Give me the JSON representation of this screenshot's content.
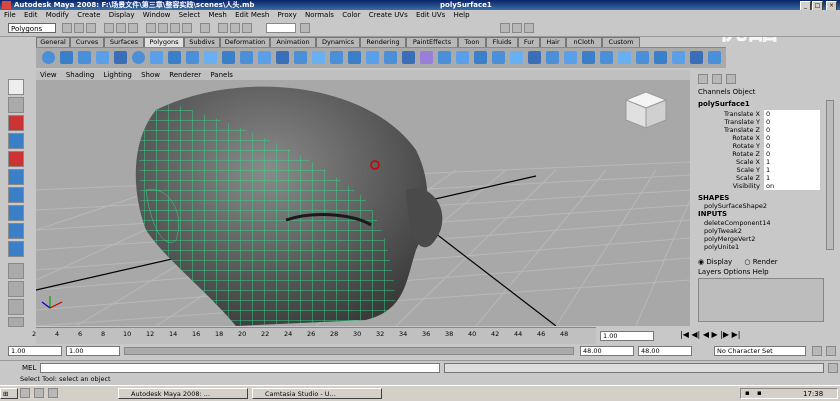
{
  "window": {
    "title": "Autodesk Maya 2008: F:\\场景文件\\第三章\\整容实践\\scenes\\人头.mb",
    "subtitle": "polySurface1",
    "controls": [
      "_",
      "□",
      "×"
    ]
  },
  "menu": [
    "File",
    "Edit",
    "Modify",
    "Create",
    "Display",
    "Window",
    "Select",
    "Mesh",
    "Edit Mesh",
    "Proxy",
    "Normals",
    "Color",
    "Create UVs",
    "Edit UVs",
    "Help"
  ],
  "status_line": {
    "mode": "Polygons"
  },
  "shelf_tabs": [
    "General",
    "Curves",
    "Surfaces",
    "Polygons",
    "Subdivs",
    "Deformation",
    "Animation",
    "Dynamics",
    "Rendering",
    "PaintEffects",
    "Toon",
    "Fluids",
    "Fur",
    "Hair",
    "nCloth",
    "Custom"
  ],
  "shelf_active": "Polygons",
  "viewport_menu": [
    "View",
    "Shading",
    "Lighting",
    "Show",
    "Renderer",
    "Panels"
  ],
  "channel_box": {
    "header": [
      "Channels",
      "Object"
    ],
    "object": "polySurface1",
    "attributes": [
      {
        "label": "Translate X",
        "value": "0"
      },
      {
        "label": "Translate Y",
        "value": "0"
      },
      {
        "label": "Translate Z",
        "value": "0"
      },
      {
        "label": "Rotate X",
        "value": "0"
      },
      {
        "label": "Rotate Y",
        "value": "0"
      },
      {
        "label": "Rotate Z",
        "value": "0"
      },
      {
        "label": "Scale X",
        "value": "1"
      },
      {
        "label": "Scale Y",
        "value": "1"
      },
      {
        "label": "Scale Z",
        "value": "1"
      },
      {
        "label": "Visibility",
        "value": "on"
      }
    ],
    "shapes_label": "SHAPES",
    "shapes": [
      "polySurfaceShape2"
    ],
    "inputs_label": "INPUTS",
    "inputs": [
      "deleteComponent14",
      "polyTweak2",
      "polyMergeVert2",
      "polyUnite1"
    ]
  },
  "layers": {
    "display": "Display",
    "render": "Render",
    "menu": [
      "Layers",
      "Options",
      "Help"
    ]
  },
  "time_slider": {
    "ticks": [
      "2",
      "4",
      "6",
      "8",
      "10",
      "12",
      "14",
      "16",
      "18",
      "20",
      "22",
      "24",
      "26",
      "28",
      "30",
      "32",
      "34",
      "36",
      "38",
      "40",
      "42",
      "44",
      "46",
      "48"
    ],
    "current": "1.00"
  },
  "range": {
    "start": "1.00",
    "inner_start": "1.00",
    "inner_end": "48.00",
    "end": "48.00",
    "char_set": "No Character Set"
  },
  "command_line": {
    "label": "MEL"
  },
  "help_line": "Select Tool: select an object",
  "taskbar": {
    "tasks": [
      "Autodesk Maya 2008: ...",
      "Camtasia Studio - U..."
    ],
    "clock": "17:38"
  },
  "watermark": "优酷",
  "colors": {
    "wire": "#33d98a",
    "viewport": "#a8a8a8",
    "head": "#6a6a6a"
  }
}
